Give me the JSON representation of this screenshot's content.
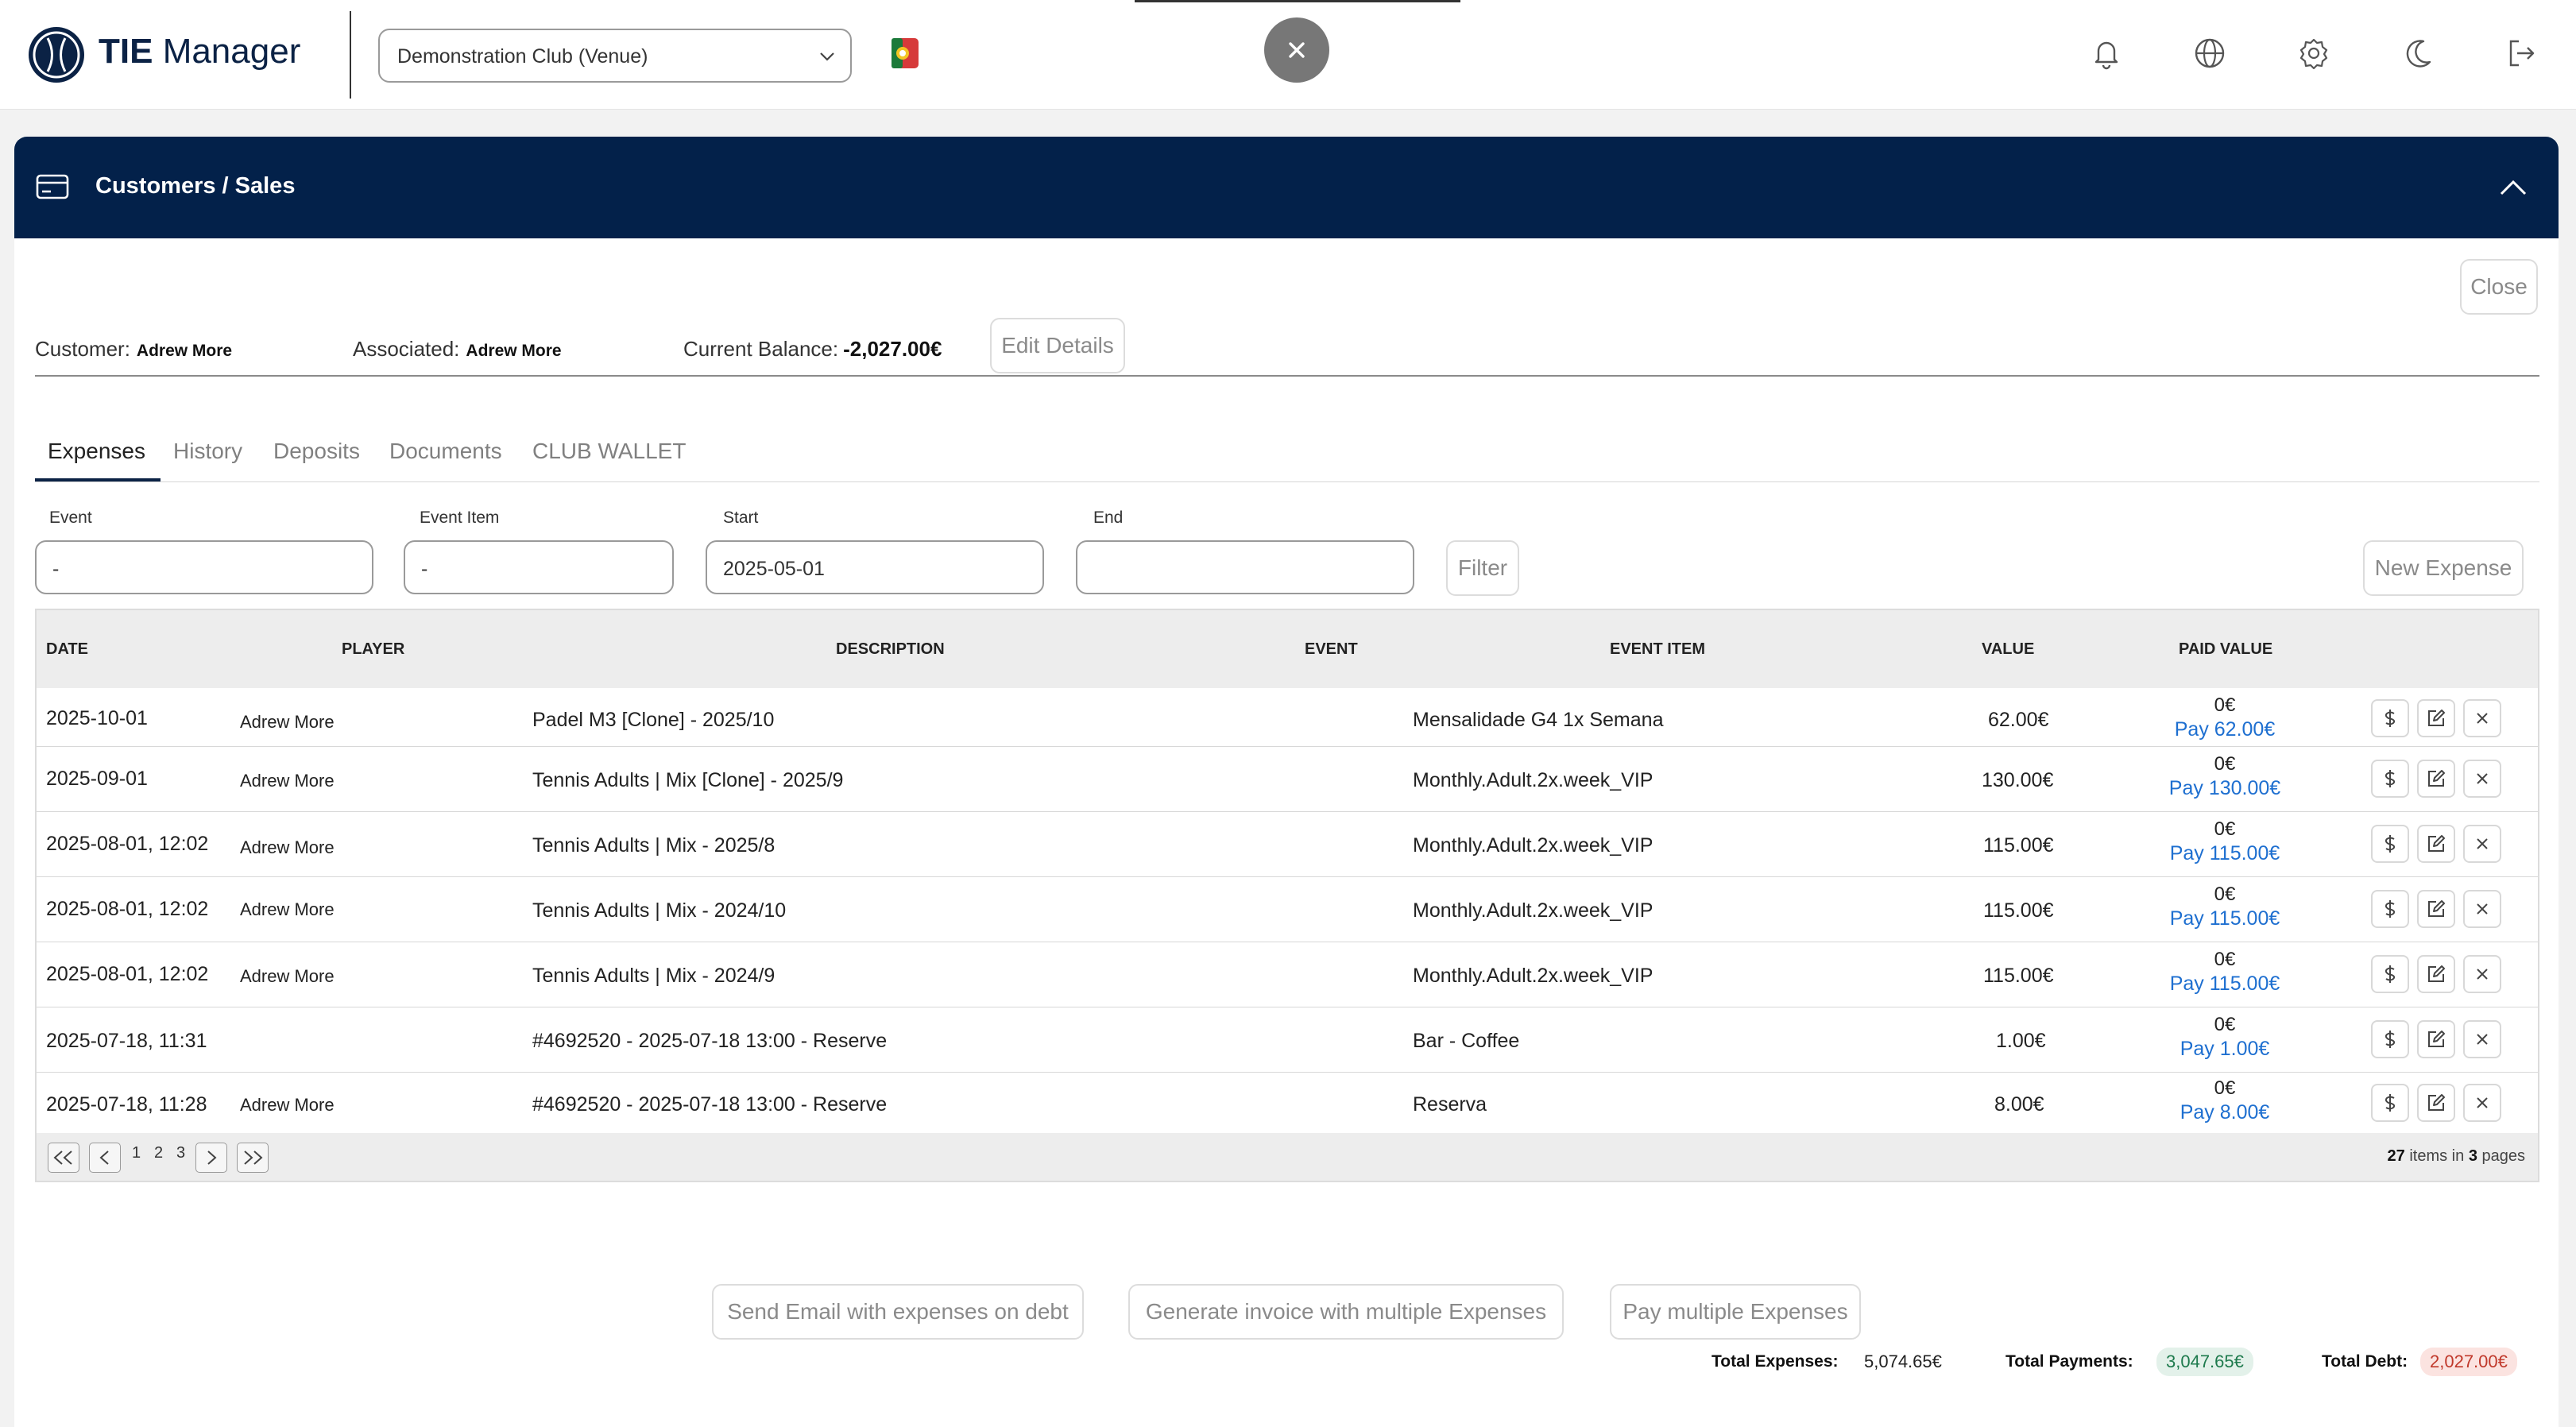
{
  "header": {
    "brand_bold": "TIE",
    "brand_rest": "Manager",
    "club_selected": "Demonstration Club (Venue)"
  },
  "card": {
    "title": "Customers / Sales",
    "close_label": "Close",
    "customer_label": "Customer:",
    "customer_value": "Adrew More",
    "associated_label": "Associated:",
    "associated_value": "Adrew More",
    "balance_label": "Current Balance:",
    "balance_value": "-2,027.00€",
    "edit_label": "Edit Details"
  },
  "tabs": [
    "Expenses",
    "History",
    "Deposits",
    "Documents",
    "CLUB WALLET"
  ],
  "filters": {
    "event_label": "Event",
    "event_value": "-",
    "event_item_label": "Event Item",
    "event_item_value": "-",
    "start_label": "Start",
    "start_value": "2025-05-01",
    "end_label": "End",
    "end_value": "",
    "filter_label": "Filter",
    "new_expense_label": "New Expense"
  },
  "table": {
    "headers": [
      "DATE",
      "PLAYER",
      "DESCRIPTION",
      "EVENT",
      "EVENT ITEM",
      "VALUE",
      "PAID VALUE"
    ],
    "rows": [
      {
        "date": "2025-10-01",
        "player": "Adrew More",
        "description": "Padel M3 [Clone] - 2025/10",
        "event": "",
        "event_item": "Mensalidade G4 1x Semana",
        "value": "62.00€",
        "paid": "0€",
        "pay": "Pay 62.00€"
      },
      {
        "date": "2025-09-01",
        "player": "Adrew More",
        "description": "Tennis Adults | Mix [Clone] - 2025/9",
        "event": "",
        "event_item": "Monthly.Adult.2x.week_VIP",
        "value": "130.00€",
        "paid": "0€",
        "pay": "Pay 130.00€"
      },
      {
        "date": "2025-08-01, 12:02",
        "player": "Adrew More",
        "description": "Tennis Adults | Mix - 2025/8",
        "event": "",
        "event_item": "Monthly.Adult.2x.week_VIP",
        "value": "115.00€",
        "paid": "0€",
        "pay": "Pay 115.00€"
      },
      {
        "date": "2025-08-01, 12:02",
        "player": "Adrew More",
        "description": "Tennis Adults | Mix - 2024/10",
        "event": "",
        "event_item": "Monthly.Adult.2x.week_VIP",
        "value": "115.00€",
        "paid": "0€",
        "pay": "Pay 115.00€"
      },
      {
        "date": "2025-08-01, 12:02",
        "player": "Adrew More",
        "description": "Tennis Adults | Mix - 2024/9",
        "event": "",
        "event_item": "Monthly.Adult.2x.week_VIP",
        "value": "115.00€",
        "paid": "0€",
        "pay": "Pay 115.00€"
      },
      {
        "date": "2025-07-18, 11:31",
        "player": "",
        "description": "#4692520 - 2025-07-18 13:00 - Reserve",
        "event": "",
        "event_item": "Bar - Coffee",
        "value": "1.00€",
        "paid": "0€",
        "pay": "Pay 1.00€"
      },
      {
        "date": "2025-07-18, 11:28",
        "player": "Adrew More",
        "description": "#4692520 - 2025-07-18 13:00 - Reserve",
        "event": "",
        "event_item": "Reserva",
        "value": "8.00€",
        "paid": "0€",
        "pay": "Pay 8.00€"
      }
    ],
    "pages": [
      "1",
      "2",
      "3"
    ],
    "items_count": "27",
    "items_mid": "items in",
    "pages_count": "3",
    "pages_word": "pages"
  },
  "totals": {
    "expenses_label": "Total Expenses:",
    "expenses_value": "5,074.65€",
    "payments_label": "Total Payments:",
    "payments_value": "3,047.65€",
    "debt_label": "Total Debt:",
    "debt_value": "2,027.00€"
  },
  "actions": {
    "send_email": "Send Email with expenses on debt",
    "generate_invoice": "Generate invoice with multiple Expenses",
    "pay_multiple": "Pay multiple Expenses"
  },
  "colors": {
    "brand_navy": "#03214a",
    "pay_link": "#1e6fd0",
    "payments_badge_bg": "#e3f1ea",
    "payments_badge_fg": "#1e7a4d",
    "debt_badge_bg": "#fbe3e0",
    "debt_badge_fg": "#c0392b"
  },
  "icons": [
    "tie-logo-icon",
    "chevron-down-icon",
    "flag-icon",
    "close-icon",
    "bell-icon",
    "globe-icon",
    "gear-icon",
    "moon-icon",
    "logout-icon",
    "credit-card-icon",
    "chevron-up-icon",
    "dollar-icon",
    "edit-icon",
    "delete-icon"
  ]
}
